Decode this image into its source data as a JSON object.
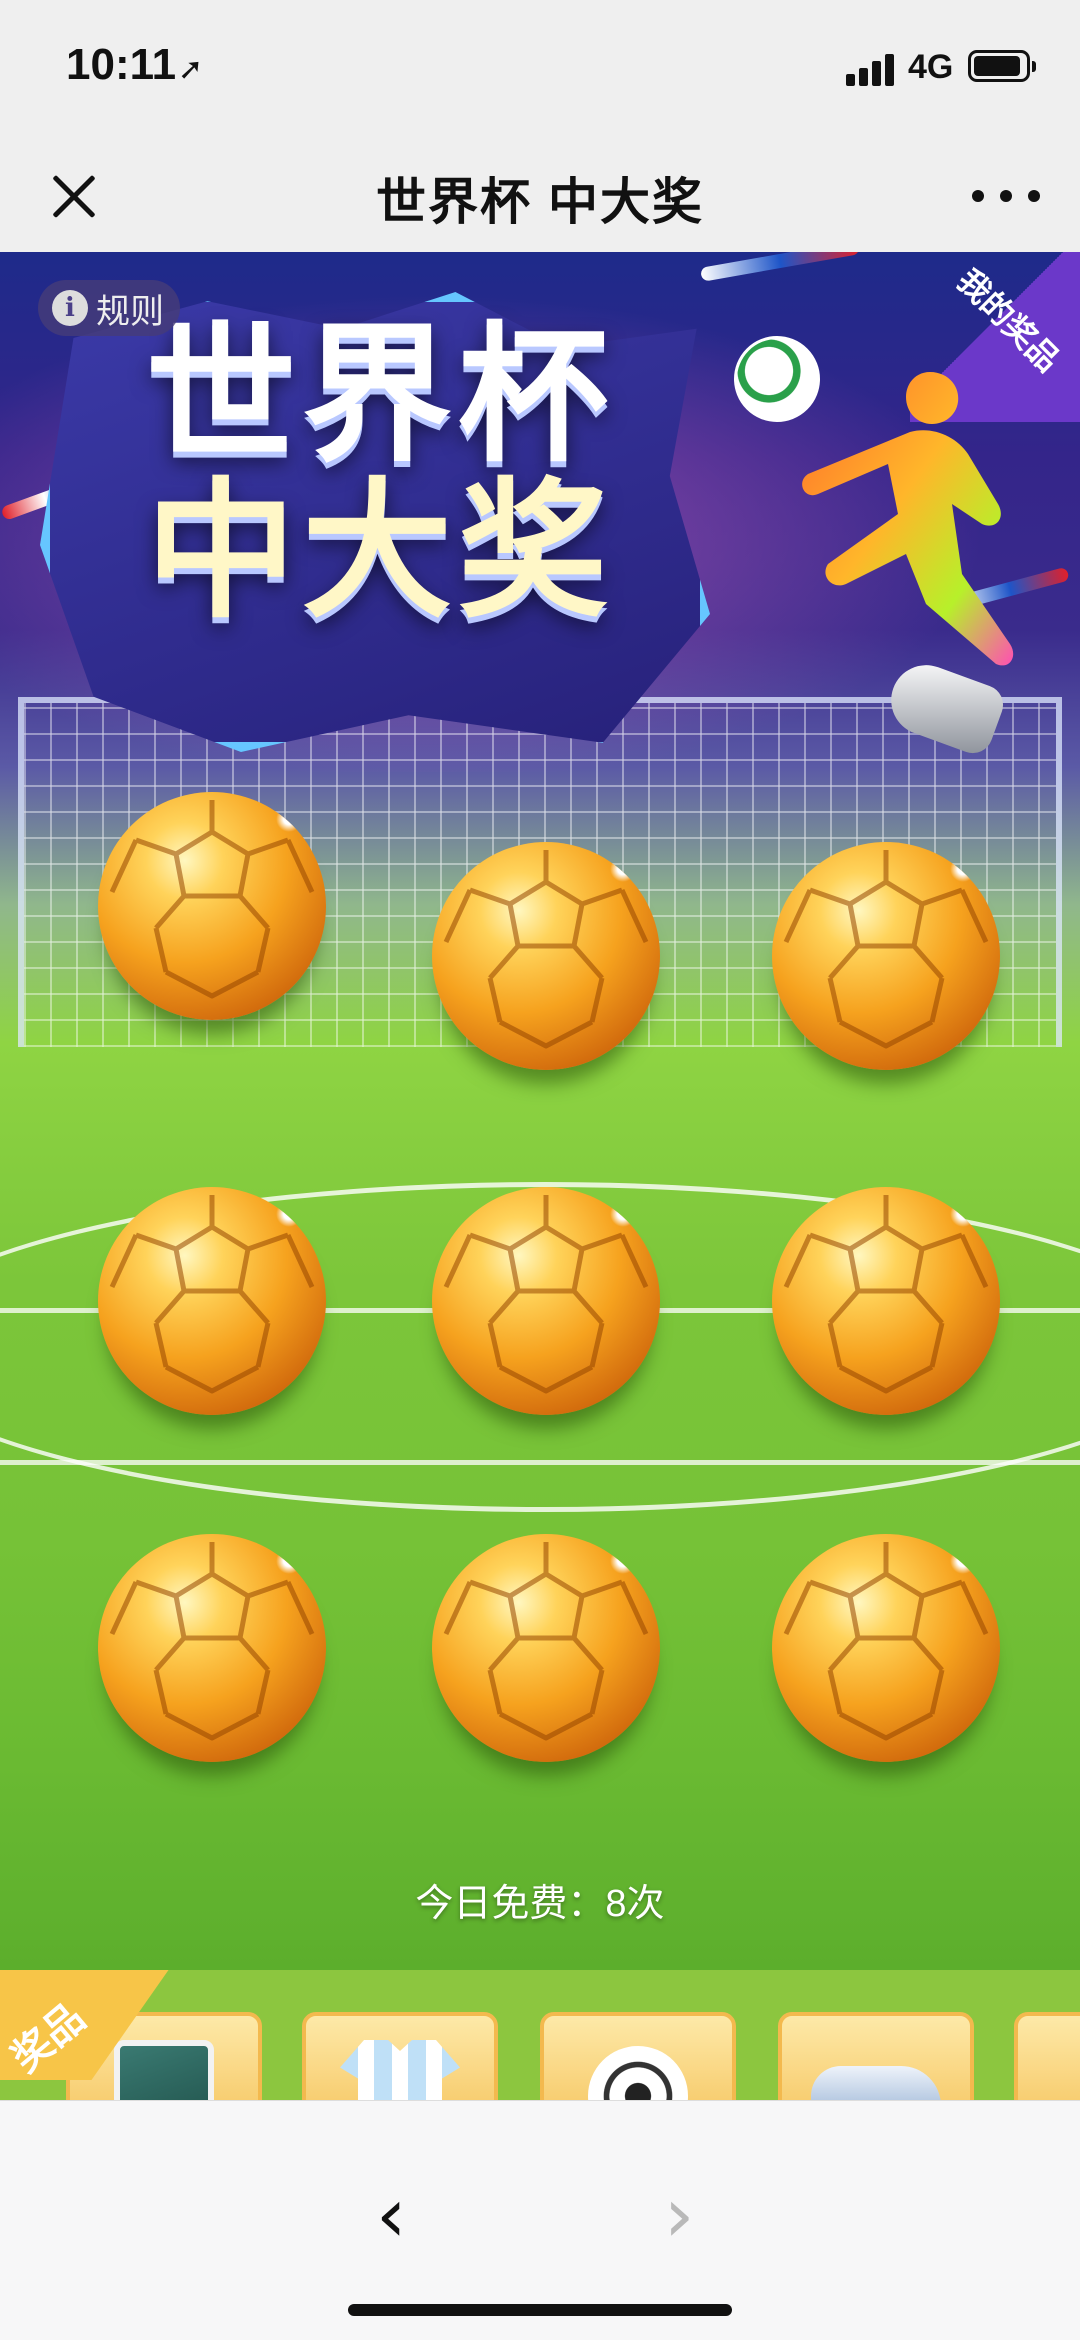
{
  "status_bar": {
    "time": "10:11",
    "network": "4G",
    "location_icon": "location-arrow-icon"
  },
  "nav": {
    "title": "世界杯 中大奖",
    "close_icon": "close-icon",
    "more_icon": "more-icon"
  },
  "banner": {
    "title_line1": "世界杯",
    "title_line2": "中大奖",
    "rules_label": "规则",
    "my_prizes_label": "我的奖品"
  },
  "game": {
    "ball_count": 9,
    "free_count_text": "今日免费：8次"
  },
  "prizes": {
    "tag": "奖品",
    "items": [
      {
        "name": "tablet",
        "icon": "tablet-icon"
      },
      {
        "name": "jersey",
        "icon": "jersey-icon"
      },
      {
        "name": "football",
        "icon": "football-icon"
      },
      {
        "name": "sneaker",
        "icon": "sneaker-icon"
      }
    ]
  },
  "toolbar": {
    "back_icon": "back-arrow-icon",
    "forward_icon": "forward-arrow-icon"
  },
  "colors": {
    "accent_purple": "#6b38c9",
    "pitch_green": "#7cc63a",
    "gold": "#f6a21e",
    "strip_green": "#8cc63f"
  }
}
